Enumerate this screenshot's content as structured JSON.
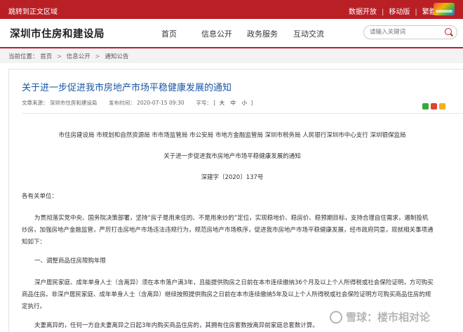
{
  "topbar": {
    "skip_link": "跳转到正文区域",
    "links": [
      "数据开放",
      "移动版",
      "繁體"
    ],
    "logo_icon": "shenzhen-government-logo"
  },
  "header": {
    "site_title": "深圳市住房和建设局",
    "nav": [
      "首页",
      "信息公开",
      "政务服务",
      "互动交流"
    ],
    "search_placeholder": "请输入关键词"
  },
  "breadcrumb": {
    "label": "当前位置：",
    "items": [
      "首页",
      "信息公开",
      "通知公告"
    ],
    "separator": ">"
  },
  "article": {
    "title": "关于进一步促进我市房地产市场平稳健康发展的通知",
    "meta": {
      "source_label": "文章来源：",
      "source": "深圳市住房和建设局",
      "date_label": "发布时间：",
      "date": "2020-07-15 09:30",
      "fontsize_label": "字号：",
      "fontsize_open": "[",
      "fontsize_options": [
        "大",
        "中",
        "小"
      ],
      "fontsize_close": "]"
    },
    "share_icons": [
      "wechat-icon",
      "weibo-icon",
      "qzone-icon"
    ],
    "issuers": "市住房建设局 市规划和自然资源局 市市场监管局 市公安局 市地方金融监管局 深圳市税务局 人民银行深圳市中心支行 深圳银保监局",
    "doc_title": "关于进一步促进我市房地产市场平稳健康发展的通知",
    "doc_number": "深建字〔2020〕137号",
    "salutation": "各有关单位：",
    "intro_lines": [
      "为贯彻落实党中央、国务院决策部署，坚持“房子是用来住的、不是用来炒的”定位，实现稳地价、稳房价、稳预期目标，支持合理自住需求，遏制投机",
      "炒房，加强房地产金融监管，严厉打击房地产市场违法违规行为，规范房地产市场秩序，促进我市房地产市场平稳健康发展，经市政府同意，现就相关事项通",
      "知如下："
    ],
    "section1_heading": "一、调整商品住房限购年限",
    "section1_lines": [
      "深户居民家庭、成年单身人士（含离异）须在本市落户满3年，且能提供购房之日前在本市连续缴纳36个月及以上个人所得税或社会保险证明，方可购买",
      "商品住房。非深户居民家庭、成年单身人士（含离异）继续按照提供购房之日前在本市连续缴纳5年及以上个人所得税或社会保险证明方可购买商品住房的规",
      "定执行。"
    ],
    "last_line": "夫妻离异的，任何一方自夫妻离异之日起3年内购买商品住房的，其拥有住房套数按离异前家庭总套数计算。"
  },
  "watermark": {
    "icon": "snowball-icon",
    "text": "雪球：楼市相对论"
  },
  "colors": {
    "brand_red": "#b82026",
    "title_blue": "#1a56a6"
  }
}
